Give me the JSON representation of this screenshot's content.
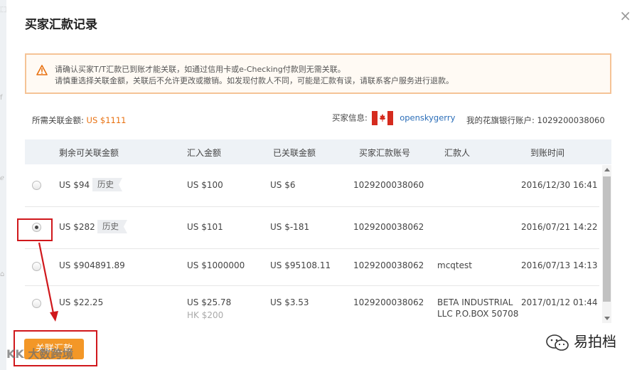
{
  "dialog": {
    "title": "买家汇款记录",
    "close_glyph": "×"
  },
  "notice": {
    "line1": "请确认买家T/T汇款已到账才能关联，如通过信用卡或e-Checking付款则无需关联。",
    "line2": "请慎重选择关联金额，关联后不允许更改或撤销。如发现付款人不同，可能是汇款有误，请联系客户服务进行退款。"
  },
  "info": {
    "required_label": "所需关联金额:",
    "required_amount": "US $1111",
    "buyer_label": "买家信息:",
    "buyer_name": "openskygerry",
    "account_label": "我的花旗银行账户:",
    "account_number": "1029200038060"
  },
  "table": {
    "headers": [
      "剩余可关联金额",
      "汇入金额",
      "已关联金额",
      "买家汇款账号",
      "汇款人",
      "到账时间"
    ],
    "rows": [
      {
        "remaining": "US $94",
        "history": "历史",
        "received": "US $100",
        "received_sub": "",
        "linked": "US $6",
        "account": "1029200038060",
        "remitter": "",
        "remitter2": "",
        "time": "2016/12/30 16:41",
        "selected": false
      },
      {
        "remaining": "US $282",
        "history": "历史",
        "received": "US $101",
        "received_sub": "",
        "linked": "US $-181",
        "account": "1029200038062",
        "remitter": "",
        "remitter2": "",
        "time": "2016/07/21 14:22",
        "selected": true
      },
      {
        "remaining": "US $904891.89",
        "history": "",
        "received": "US $1000000",
        "received_sub": "",
        "linked": "US $95108.11",
        "account": "1029200038062",
        "remitter": "mcqtest",
        "remitter2": "",
        "time": "2016/07/13 14:13",
        "selected": false
      },
      {
        "remaining": "US $22.25",
        "history": "",
        "received": "US $25.78",
        "received_sub": "HK $200",
        "linked": "US $3.53",
        "account": "1029200038062",
        "remitter": "BETA INDUSTRIAL",
        "remitter2": "LLC P.O.BOX 50708",
        "time": "2017/01/12 01:44",
        "selected": false
      }
    ]
  },
  "actions": {
    "link_button": "关联汇款"
  },
  "watermarks": {
    "left": "KK 大数跨境",
    "right": "易拍档"
  },
  "colors": {
    "accent_orange": "#e8700f",
    "button_orange": "#f39727",
    "highlight_red": "#d0181c",
    "link_blue": "#2a6db8"
  },
  "icons": [
    "warning-icon",
    "canada-flag-icon",
    "close-icon",
    "scroll-up-icon",
    "scroll-down-icon",
    "arrow-annotation-icon",
    "wechat-icon"
  ]
}
